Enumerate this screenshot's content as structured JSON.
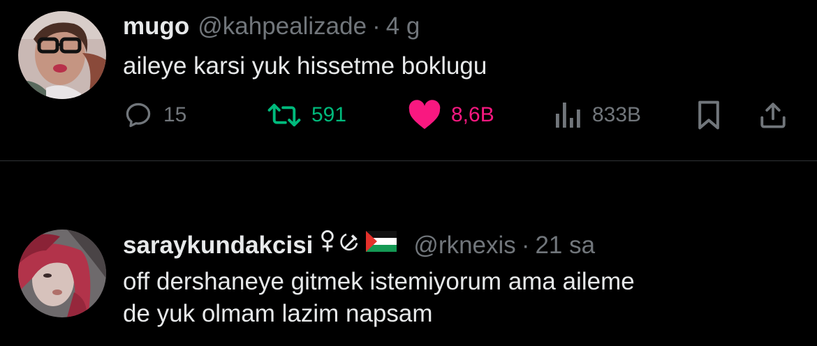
{
  "tweets": [
    {
      "name": "mugo",
      "handle": "@kahpealizade",
      "separator": "·",
      "time": "4 g",
      "text": "aileye karsi yuk hissetme boklugu",
      "actions": {
        "replies": "15",
        "retweets": "591",
        "likes": "8,6B",
        "views": "833B"
      },
      "colors": {
        "retweet": "#00ba7c",
        "like": "#f91880",
        "muted": "#71767b"
      }
    },
    {
      "name": "saraykundakcisi",
      "badges": [
        "female-sign-icon",
        "hammer-sickle-icon",
        "palestine-flag-icon"
      ],
      "handle": "@rknexis",
      "separator": "·",
      "time": "21 sa",
      "text_lines": [
        "off dershaneye gitmek istemiyorum ama aileme",
        "de yuk olmam lazim napsam"
      ]
    }
  ]
}
